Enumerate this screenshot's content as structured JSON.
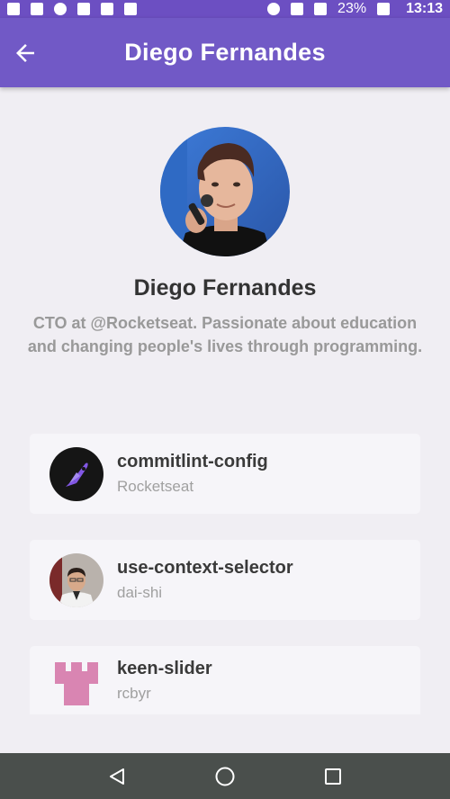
{
  "status_bar": {
    "battery": "23%",
    "time": "13:13"
  },
  "app_bar": {
    "title": "Diego Fernandes",
    "back_icon": "arrow-left-icon"
  },
  "profile": {
    "name": "Diego Fernandes",
    "bio": "CTO at @Rocketseat. Passionate about education and changing people's lives through programming."
  },
  "repositories": [
    {
      "title": "commitlint-config",
      "owner": "Rocketseat",
      "avatar_icon": "rocketseat-logo"
    },
    {
      "title": "use-context-selector",
      "owner": "dai-shi",
      "avatar_icon": "person-photo"
    },
    {
      "title": "keen-slider",
      "owner": "rcbyr",
      "avatar_icon": "pink-castle-avatar"
    }
  ],
  "nav_bar": {
    "icons": [
      "back-triangle-icon",
      "home-circle-icon",
      "recents-square-icon"
    ]
  },
  "colors": {
    "app_bar": "#7159c6",
    "background": "#f0eef3",
    "card": "#f6f5f9",
    "nav_bar": "#4a4f4c"
  }
}
